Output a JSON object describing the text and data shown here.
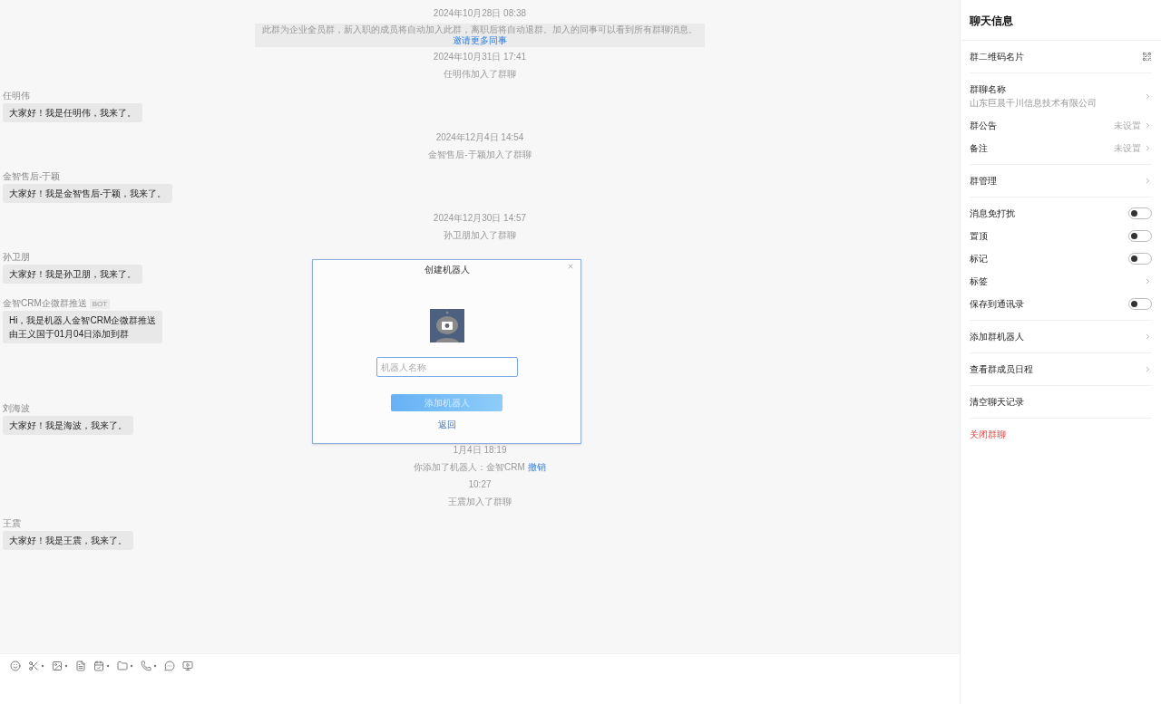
{
  "timeline": [
    {
      "kind": "time",
      "text": "2024年10月28日 08:38"
    },
    {
      "kind": "notice",
      "text": "此群为企业全员群，新入职的成员将自动加入此群，离职后将自动退群。加入的同事可以看到所有群聊消息。",
      "link": "邀请更多同事"
    },
    {
      "kind": "time",
      "text": "2024年10月31日 17:41"
    },
    {
      "kind": "system",
      "text": "任明伟加入了群聊"
    },
    {
      "kind": "message",
      "sender": "任明伟",
      "lines": [
        "大家好！我是任明伟，我来了。"
      ]
    },
    {
      "kind": "time",
      "text": "2024年12月4日 14:54"
    },
    {
      "kind": "system",
      "text": "金智售后-于颖加入了群聊"
    },
    {
      "kind": "message",
      "sender": "金智售后-于颖",
      "lines": [
        "大家好！我是金智售后-于颖，我来了。"
      ]
    },
    {
      "kind": "time",
      "text": "2024年12月30日 14:57"
    },
    {
      "kind": "system",
      "text": "孙卫朋加入了群聊"
    },
    {
      "kind": "message",
      "sender": "孙卫朋",
      "lines": [
        "大家好！我是孙卫朋，我来了。"
      ]
    },
    {
      "kind": "message",
      "sender": "金智CRM企微群推送",
      "badge": "BOT",
      "lines": [
        "Hi，我是机器人金智CRM企微群推送",
        "由王义国于01月04日添加到群"
      ]
    },
    {
      "kind": "message",
      "sender": "刘海波",
      "lines": [
        "大家好！我是海波，我来了。"
      ]
    },
    {
      "kind": "time",
      "text": "1月4日 18:19"
    },
    {
      "kind": "system",
      "text": "你添加了机器人：金智CRM",
      "link": "撤销"
    },
    {
      "kind": "time",
      "text": "10:27"
    },
    {
      "kind": "system",
      "text": "王震加入了群聊"
    },
    {
      "kind": "message",
      "sender": "王震",
      "lines": [
        "大家好！我是王震，我来了。"
      ]
    }
  ],
  "dialog": {
    "title": "创建机器人",
    "placeholder": "机器人名称",
    "button": "添加机器人",
    "back": "返回"
  },
  "panel": {
    "title": "聊天信息",
    "sections": [
      [
        {
          "kind": "qr",
          "label": "群二维码名片"
        }
      ],
      [
        {
          "kind": "link",
          "label": "群聊名称",
          "sub": "山东巨晨千川信息技术有限公司"
        },
        {
          "kind": "link",
          "label": "群公告",
          "value": "未设置"
        },
        {
          "kind": "link",
          "label": "备注",
          "value": "未设置"
        }
      ],
      [
        {
          "kind": "link",
          "label": "群管理"
        }
      ],
      [
        {
          "kind": "toggle",
          "label": "消息免打扰",
          "on": false
        },
        {
          "kind": "toggle",
          "label": "置顶",
          "on": false
        },
        {
          "kind": "toggle",
          "label": "标记",
          "on": false
        },
        {
          "kind": "link",
          "label": "标签"
        },
        {
          "kind": "toggle",
          "label": "保存到通讯录",
          "on": false
        }
      ],
      [
        {
          "kind": "link",
          "label": "添加群机器人"
        }
      ],
      [
        {
          "kind": "link",
          "label": "查看群成员日程"
        }
      ],
      [
        {
          "kind": "plain",
          "label": "清空聊天记录"
        }
      ],
      [
        {
          "kind": "danger",
          "label": "关闭群聊"
        }
      ]
    ]
  }
}
